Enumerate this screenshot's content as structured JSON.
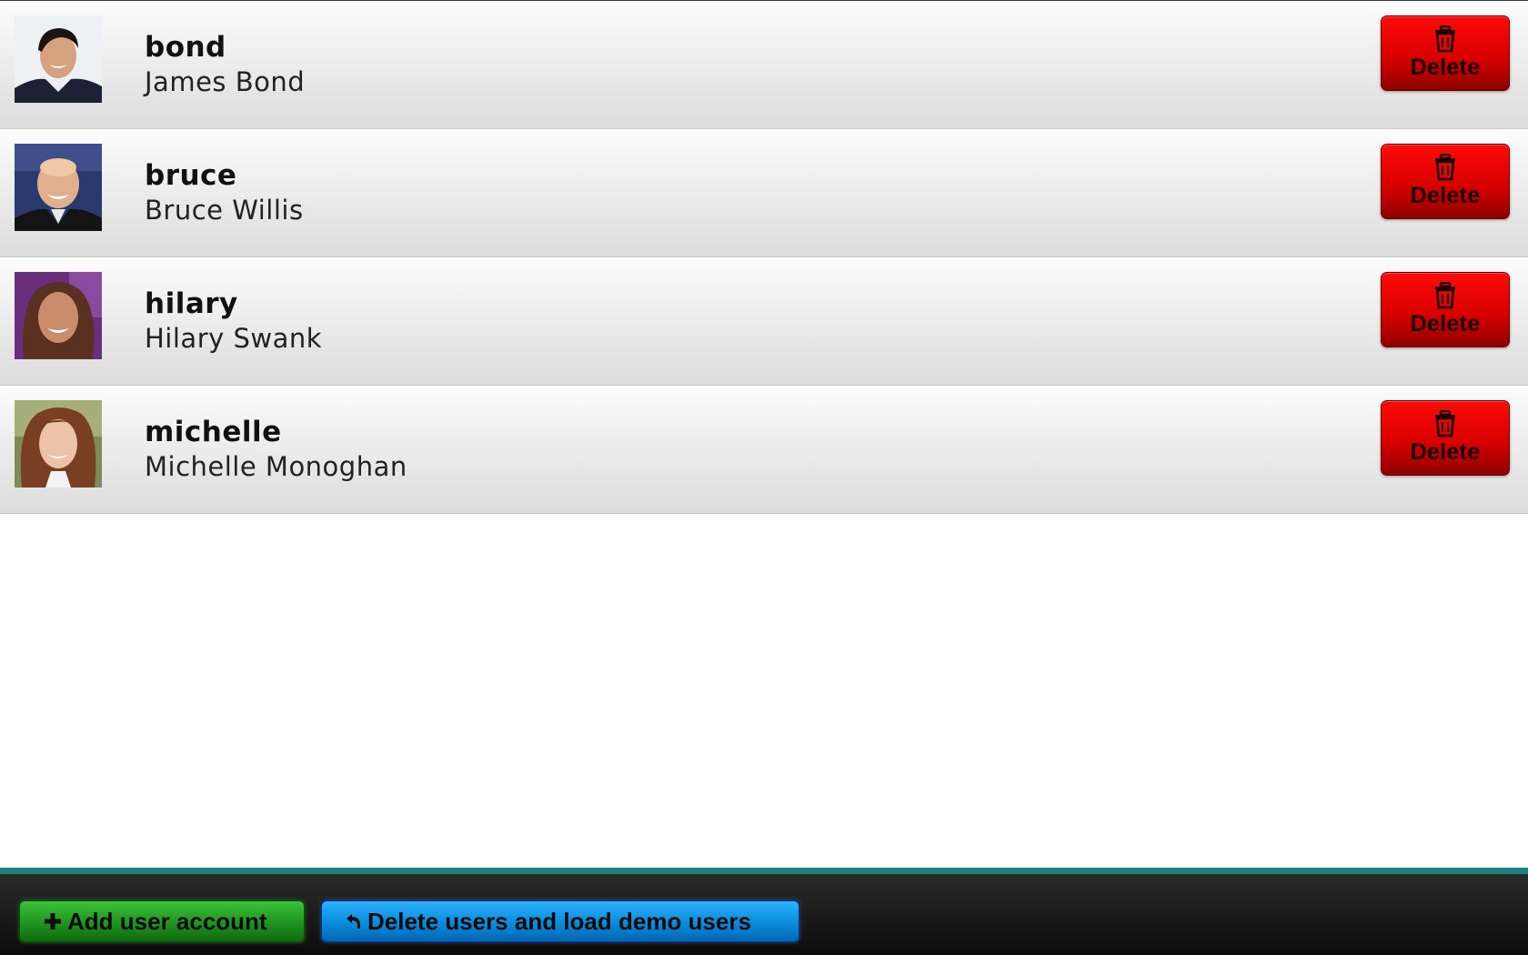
{
  "users": [
    {
      "username": "bond",
      "fullname": "James Bond",
      "delete_label": "Delete"
    },
    {
      "username": "bruce",
      "fullname": "Bruce Willis",
      "delete_label": "Delete"
    },
    {
      "username": "hilary",
      "fullname": "Hilary Swank",
      "delete_label": "Delete"
    },
    {
      "username": "michelle",
      "fullname": "Michelle Monoghan",
      "delete_label": "Delete"
    }
  ],
  "footer": {
    "add_label": "Add user account",
    "demo_label": "Delete users and load demo users",
    "add_icon": "plus-icon",
    "demo_icon": "undo-icon"
  },
  "colors": {
    "delete_button": "#e00000",
    "add_button": "#1d8f1d",
    "demo_button": "#0787d8",
    "footer_accent": "#17857f"
  }
}
